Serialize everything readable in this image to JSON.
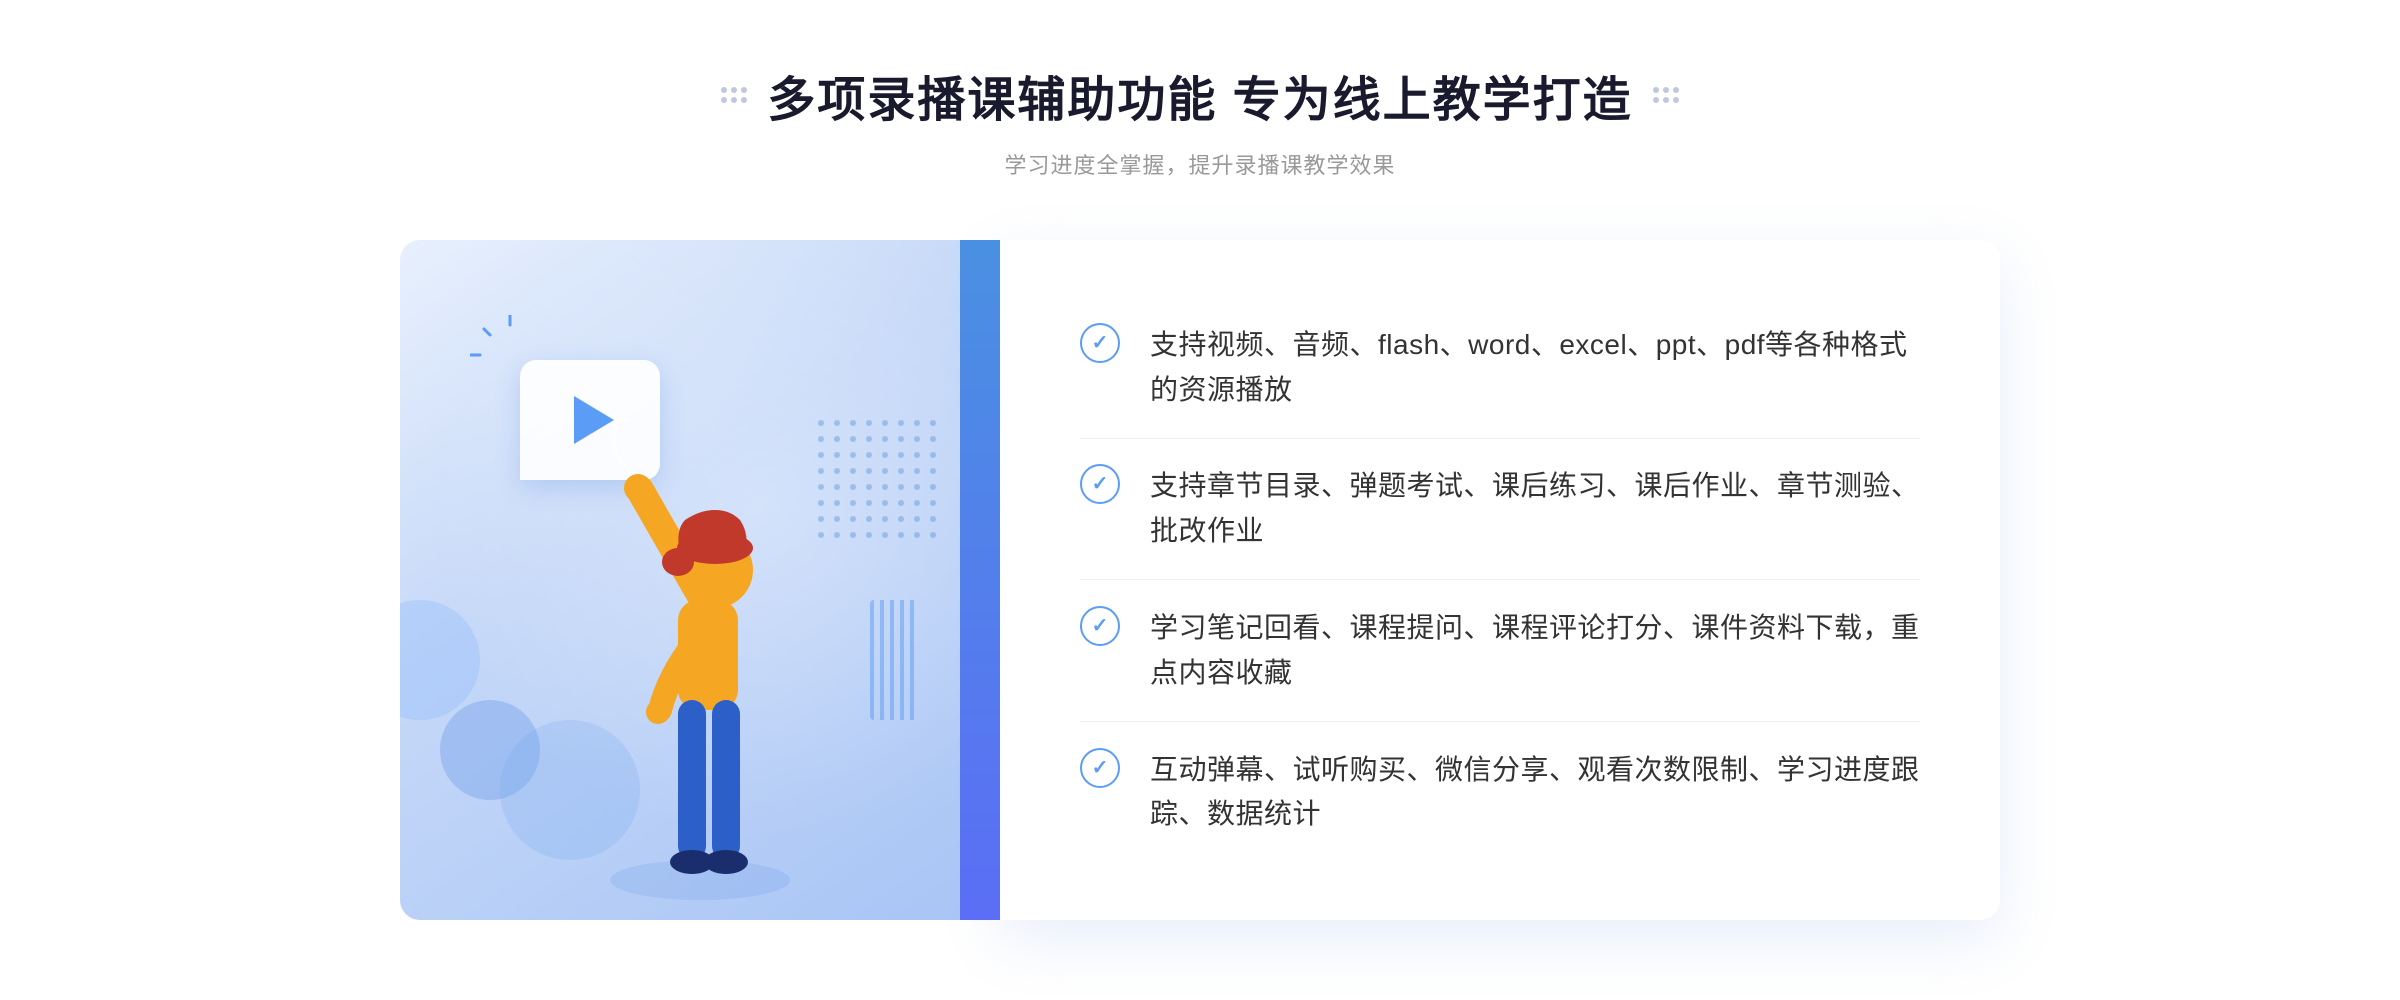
{
  "header": {
    "title": "多项录播课辅助功能 专为线上教学打造",
    "subtitle": "学习进度全掌握，提升录播课教学效果"
  },
  "features": [
    {
      "id": "feature-1",
      "text": "支持视频、音频、flash、word、excel、ppt、pdf等各种格式的资源播放"
    },
    {
      "id": "feature-2",
      "text": "支持章节目录、弹题考试、课后练习、课后作业、章节测验、批改作业"
    },
    {
      "id": "feature-3",
      "text": "学习笔记回看、课程提问、课程评论打分、课件资料下载，重点内容收藏"
    },
    {
      "id": "feature-4",
      "text": "互动弹幕、试听购买、微信分享、观看次数限制、学习进度跟踪、数据统计"
    }
  ],
  "colors": {
    "primary": "#5b9cf6",
    "title": "#1a1a2e",
    "subtitle": "#999999",
    "text": "#333333",
    "divider": "#f0f0f0"
  },
  "icons": {
    "check": "✓",
    "play": "▶",
    "chevron": "»"
  }
}
